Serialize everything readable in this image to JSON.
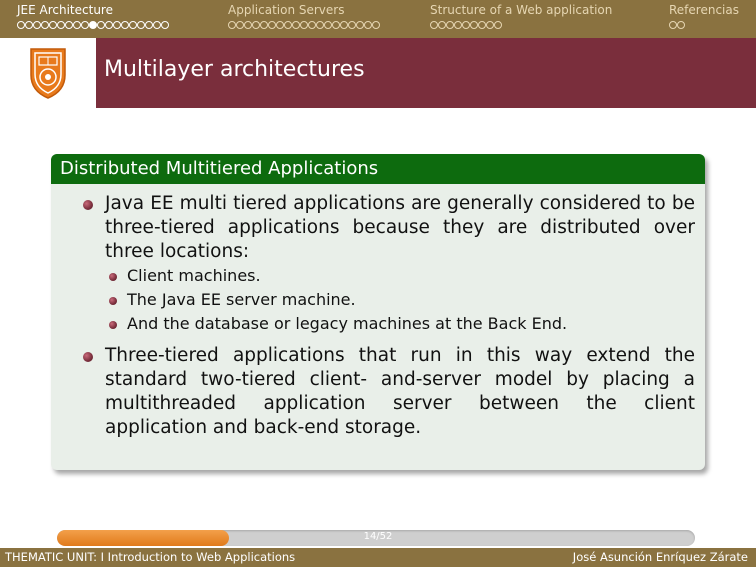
{
  "nav": {
    "sections": [
      {
        "label": "JEE Architecture",
        "dots": 19,
        "current_dot": 9,
        "active": true
      },
      {
        "label": "Application Servers",
        "dots": 19,
        "current_dot": -1,
        "active": false
      },
      {
        "label": "Structure of a Web application",
        "dots": 9,
        "current_dot": -1,
        "active": false
      },
      {
        "label": "Referencias",
        "dots": 2,
        "current_dot": -1,
        "active": false
      }
    ]
  },
  "slide": {
    "title": "Multilayer architectures",
    "block_title": "Distributed Multitiered Applications",
    "bullet1": "Java EE multi tiered applications are generally considered to be three-tiered applications because they are distributed over three locations:",
    "subitems": [
      "Client machines.",
      "The Java EE server machine.",
      "And the database or legacy machines at the Back End."
    ],
    "bullet2": "Three-tiered applications that run in this way extend the standard two-tiered client- and-server model by placing a multithreaded application server between the client application and back-end storage."
  },
  "progress": {
    "label": "14/52",
    "current": 14,
    "total": 52
  },
  "footer": {
    "left": "THEMATIC UNIT: I Introduction to Web Applications",
    "right": "José Asunción Enríquez Zárate"
  },
  "colors": {
    "nav_bg": "#8a7240",
    "title_bg": "#7a2e3c",
    "block_head": "#0d6b0e",
    "block_body": "#e9efe9",
    "progress_fill": "#e07a1b"
  },
  "icons": {
    "logo": "ipn-shield-logo"
  }
}
